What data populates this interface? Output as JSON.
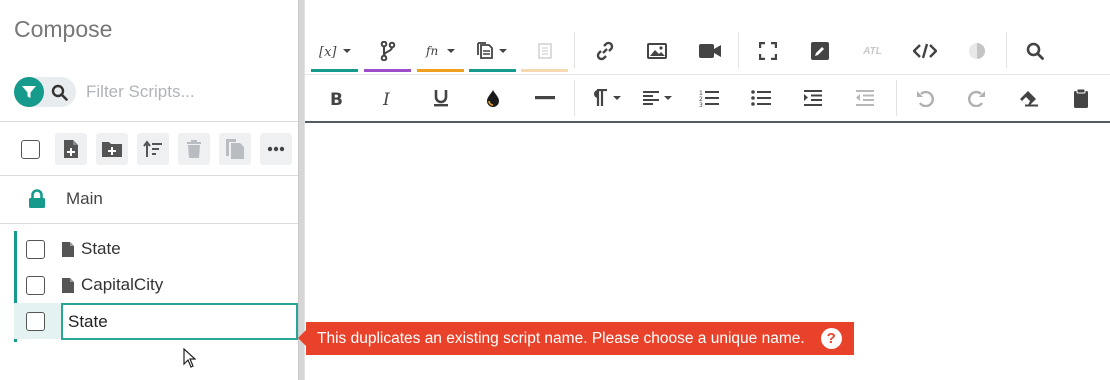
{
  "sidebar": {
    "title": "Compose",
    "filter": {
      "placeholder": "Filter Scripts..."
    },
    "toolbar": {
      "select_all": "select-all-checkbox",
      "buttons": [
        "new-script",
        "new-folder",
        "sort",
        "delete",
        "copy",
        "more"
      ]
    },
    "main_folder": {
      "label": "Main",
      "icon": "lock-icon"
    },
    "scripts": [
      {
        "name": "State"
      },
      {
        "name": "CapitalCity"
      }
    ],
    "rename": {
      "value": "State"
    }
  },
  "editor": {
    "toolbar_row1": [
      "variables",
      "branch",
      "functions",
      "snippets",
      "book",
      "link",
      "image",
      "video",
      "fullscreen",
      "edit",
      "atl",
      "code",
      "contrast",
      "search"
    ],
    "toolbar_row2": [
      "bold",
      "italic",
      "underline",
      "text-color",
      "horizontal-rule",
      "paragraph",
      "align",
      "ordered-list",
      "bullet-list",
      "indent",
      "outdent",
      "undo",
      "redo",
      "eraser",
      "paste"
    ],
    "atl_label": "ATL",
    "accent_colors": {
      "variables": "#159a8c",
      "branch": "#9b4dca",
      "functions": "#f0a020",
      "snippets": "#159a8c",
      "book": "#f5d9b0"
    }
  },
  "error": {
    "message": "This duplicates an existing script name. Please choose a unique name.",
    "help_icon": "?"
  },
  "colors": {
    "teal": "#159a8c",
    "error_red": "#e8422a"
  }
}
